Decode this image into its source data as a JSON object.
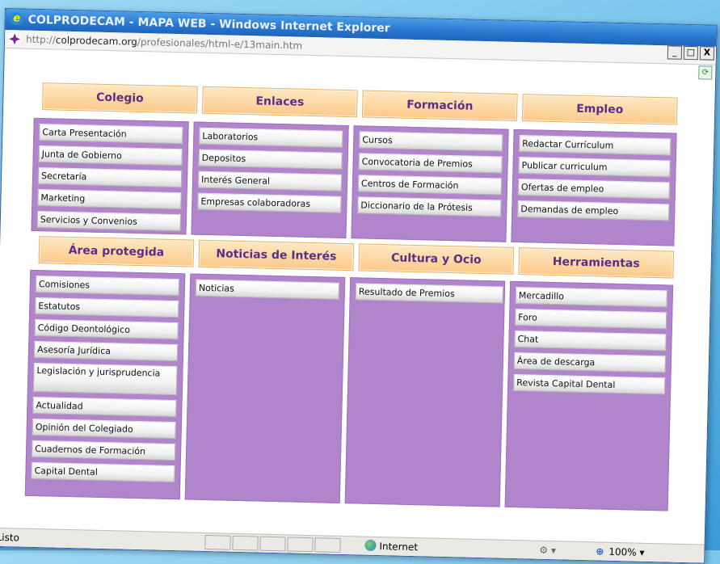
{
  "window": {
    "title": "COLPRODECAM - MAPA WEB - Windows Internet Explorer",
    "address": {
      "scheme": "http://",
      "host": "colprodecam.org",
      "path": "/profesionales/html-e/13main.htm"
    },
    "controls": {
      "minimize": "_",
      "maximize": "□",
      "close": "X"
    }
  },
  "sections": [
    {
      "title": "Colegio",
      "items": [
        "Carta Presentación",
        "Junta de Gobierno",
        "Secretaría",
        "Marketing",
        "Servicios y Convenios"
      ]
    },
    {
      "title": "Enlaces",
      "items": [
        "Laboratorios",
        "Depositos",
        "Interés General",
        "Empresas colaboradoras"
      ]
    },
    {
      "title": "Formación",
      "items": [
        "Cursos",
        "Convocatoria de Premios",
        "Centros de Formación",
        "Diccionario de la Prótesis"
      ]
    },
    {
      "title": "Empleo",
      "items": [
        "Redactar Currículum",
        "Publicar curriculum",
        "Ofertas de empleo",
        "Demandas de empleo"
      ]
    },
    {
      "title": "Área protegida",
      "items": [
        "Comisiones",
        "Estatutos",
        "Código Deontológico",
        "Asesoría Jurídica",
        "Legislación y jurisprudencia",
        "Actualidad",
        "Opinión del Colegiado",
        "Cuadernos de Formación",
        "Capital Dental"
      ]
    },
    {
      "title": "Noticias de Interés",
      "items": [
        "Noticias"
      ]
    },
    {
      "title": "Cultura y Ocio",
      "items": [
        "Resultado de Premios"
      ]
    },
    {
      "title": "Herramientas",
      "items": [
        "Mercadillo",
        "Foro",
        "Chat",
        "Área de descarga",
        "Revista Capital Dental"
      ]
    }
  ],
  "status": {
    "text": "Listo",
    "zone": "Internet",
    "zoom": "100%"
  },
  "colors": {
    "panel": "#b185cc",
    "header_text": "#5a2e86",
    "titlebar": "#2b78d0"
  }
}
